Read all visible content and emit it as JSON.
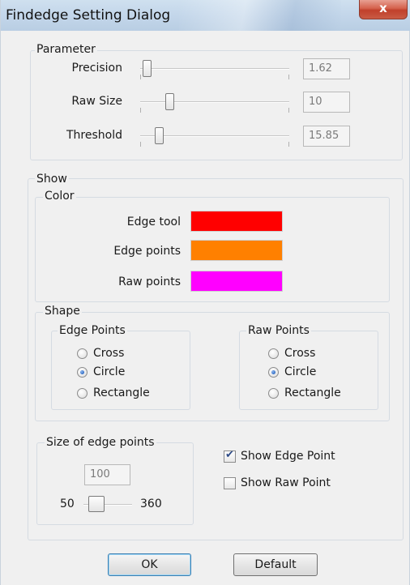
{
  "window": {
    "title": "Findedge Setting Dialog",
    "close_symbol": "x"
  },
  "parameter": {
    "legend": "Parameter",
    "rows": [
      {
        "label": "Precision",
        "value": "1.62",
        "slider_fraction": 0.05
      },
      {
        "label": "Raw Size",
        "value": "10",
        "slider_fraction": 0.22
      },
      {
        "label": "Threshold",
        "value": "15.85",
        "slider_fraction": 0.13
      }
    ]
  },
  "show": {
    "legend": "Show",
    "color": {
      "legend": "Color",
      "items": [
        {
          "label": "Edge tool",
          "color": "#ff0000"
        },
        {
          "label": "Edge points",
          "color": "#ff8000"
        },
        {
          "label": "Raw points",
          "color": "#ff00ff"
        }
      ]
    },
    "shape": {
      "legend": "Shape",
      "edge_points": {
        "legend": "Edge Points",
        "options": [
          "Cross",
          "Circle",
          "Rectangle"
        ],
        "selected": "Circle"
      },
      "raw_points": {
        "legend": "Raw Points",
        "options": [
          "Cross",
          "Circle",
          "Rectangle"
        ],
        "selected": "Circle"
      }
    },
    "size": {
      "legend": "Size of edge points",
      "value": "100",
      "min_label": "50",
      "max_label": "360",
      "slider_fraction": 0.18
    },
    "checks": [
      {
        "label": "Show Edge Point",
        "checked": true
      },
      {
        "label": "Show Raw Point",
        "checked": false
      }
    ]
  },
  "buttons": {
    "ok": "OK",
    "default": "Default"
  }
}
